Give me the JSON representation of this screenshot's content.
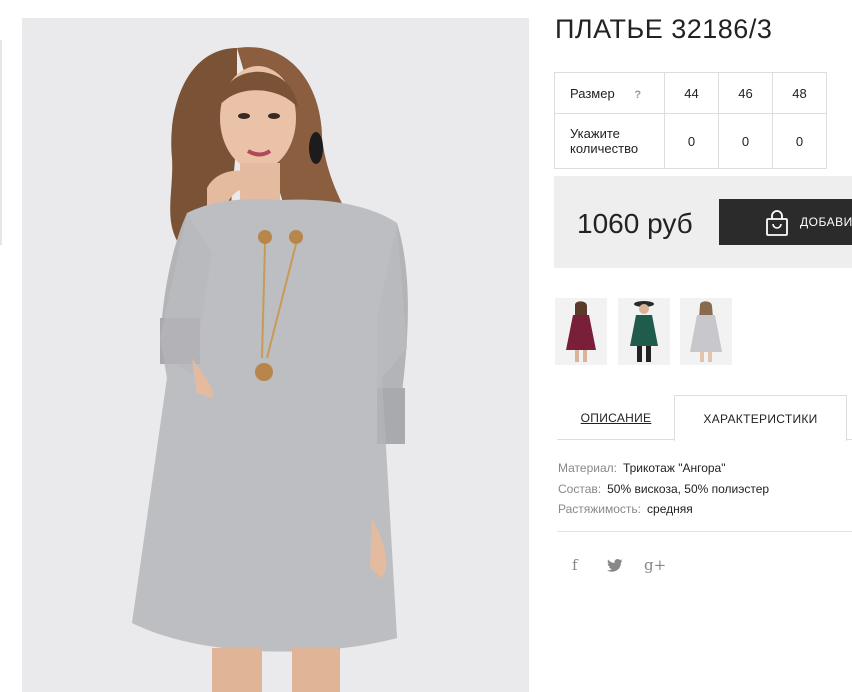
{
  "product": {
    "title": "ПЛАТЬЕ 32186/3"
  },
  "size_table": {
    "size_label": "Размер",
    "help_icon": "?",
    "sizes": [
      "44",
      "46",
      "48"
    ],
    "quantity_label_line1": "Укажите",
    "quantity_label_line2": "количество",
    "quantities": [
      "0",
      "0",
      "0"
    ]
  },
  "purchase": {
    "price": "1060 руб",
    "add_button_label": "ДОБАВИ",
    "add_icon": "shopping-bag-icon"
  },
  "thumbnails": [
    {
      "name": "burgundy-dress",
      "color": "#7a1f3a"
    },
    {
      "name": "green-dress",
      "color": "#1f5c4c"
    },
    {
      "name": "grey-dress",
      "color": "#c8c8cc"
    }
  ],
  "tabs": {
    "description": "ОПИСАНИЕ",
    "characteristics": "ХАРАКТЕРИСТИКИ",
    "active": "characteristics"
  },
  "characteristics": [
    {
      "label": "Материал:",
      "value": "Трикотаж \"Ангора\""
    },
    {
      "label": "Состав:",
      "value": "50% вискоза, 50% полиэстер"
    },
    {
      "label": "Растяжимость:",
      "value": "средняя"
    }
  ],
  "social": {
    "facebook": "f",
    "twitter_icon": "twitter-icon",
    "googleplus": "g+"
  },
  "colors": {
    "button_bg": "#2b2b2b",
    "price_bar_bg": "#eeeeee",
    "photo_bg": "#eaeaec"
  }
}
